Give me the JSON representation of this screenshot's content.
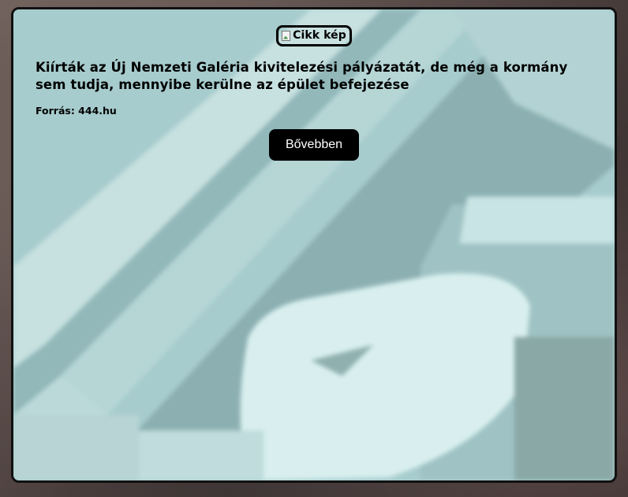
{
  "article": {
    "image_alt": "Cikk kép",
    "title": "Kiírták az Új Nemzeti Galéria kivitelezési pályázatát, de még a kormány sem tudja, mennyibe kerülne az épület befejezése",
    "source": "Forrás: 444.hu",
    "more_button": "Bővebben"
  },
  "colors": {
    "card_overlay": "#a9cfd0",
    "button_bg": "#000000",
    "button_text": "#ffffff",
    "border": "#111111"
  },
  "icons": {
    "broken_image": "broken-image-icon"
  }
}
